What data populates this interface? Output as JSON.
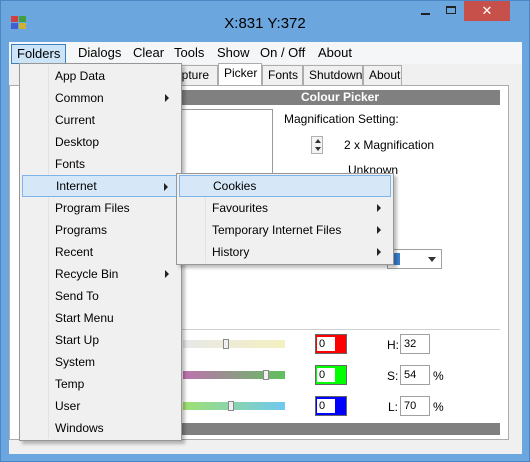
{
  "window": {
    "title": "X:831 Y:372",
    "close_glyph": "✕"
  },
  "menubar": [
    "Folders",
    "Dialogs",
    "Clear",
    "Tools",
    "Show",
    "On / Off",
    "About"
  ],
  "tabs": {
    "capture": "apture",
    "picker": "Picker",
    "fonts": "Fonts",
    "shutdown": "Shutdown",
    "about": "About"
  },
  "picker": {
    "header": "Colour Picker",
    "magnification_label": "Magnification Setting:",
    "magnification_value": "2 x Magnification",
    "unknown": "Unknown",
    "rgb": {
      "r": "0",
      "g": "0",
      "b": "0"
    },
    "hsl": {
      "h_label": "H:",
      "h": "32",
      "s_label": "S:",
      "s": "54",
      "l_label": "L:",
      "l": "70",
      "percent": "%"
    },
    "colors": {
      "red": "#ff0000",
      "green": "#00ff00",
      "blue": "#0000ff"
    }
  },
  "folders_menu": [
    {
      "label": "App Data"
    },
    {
      "label": "Common",
      "submenu": true
    },
    {
      "label": "Current"
    },
    {
      "label": "Desktop"
    },
    {
      "label": "Fonts"
    },
    {
      "label": "Internet",
      "submenu": true
    },
    {
      "label": "Program Files"
    },
    {
      "label": "Programs"
    },
    {
      "label": "Recent"
    },
    {
      "label": "Recycle Bin",
      "submenu": true
    },
    {
      "label": "Send To"
    },
    {
      "label": "Start Menu"
    },
    {
      "label": "Start Up"
    },
    {
      "label": "System"
    },
    {
      "label": "Temp"
    },
    {
      "label": "User"
    },
    {
      "label": "Windows"
    }
  ],
  "internet_submenu": [
    {
      "label": "Cookies"
    },
    {
      "label": "Favourites",
      "submenu": true
    },
    {
      "label": "Temporary Internet Files",
      "submenu": true
    },
    {
      "label": "History",
      "submenu": true
    }
  ]
}
